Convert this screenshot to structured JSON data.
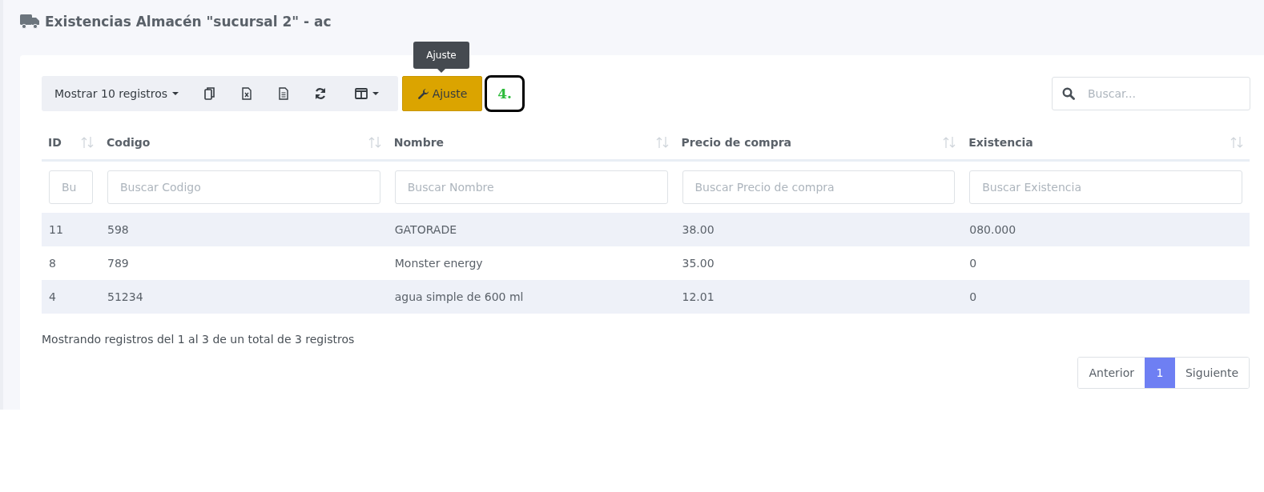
{
  "page_title": "Existencias Almacén \"sucursal 2\" - ac",
  "toolbar": {
    "length_menu": "Mostrar 10 registros",
    "buttons": [
      {
        "kind": "copy"
      },
      {
        "kind": "excel"
      },
      {
        "kind": "document"
      },
      {
        "kind": "refresh"
      },
      {
        "kind": "columns"
      }
    ],
    "adjust_button": "Ajuste",
    "tooltip": "Ajuste",
    "step_badge": "4."
  },
  "search": {
    "placeholder": "Buscar..."
  },
  "table": {
    "columns": [
      {
        "label": "ID",
        "filter_placeholder": "Bu"
      },
      {
        "label": "Codigo",
        "filter_placeholder": "Buscar Codigo"
      },
      {
        "label": "Nombre",
        "filter_placeholder": "Buscar Nombre"
      },
      {
        "label": "Precio de compra",
        "filter_placeholder": "Buscar Precio de compra"
      },
      {
        "label": "Existencia",
        "filter_placeholder": "Buscar Existencia"
      }
    ],
    "rows": [
      [
        "11",
        "598",
        "GATORADE",
        "38.00",
        "080.000"
      ],
      [
        "8",
        "789",
        "Monster energy",
        "35.00",
        "0"
      ],
      [
        "4",
        "51234",
        "agua simple de 600 ml",
        "12.01",
        "0"
      ]
    ]
  },
  "info": "Mostrando registros del 1 al 3 de un total de 3 registros",
  "pagination": {
    "previous": "Anterior",
    "pages": [
      {
        "label": "1",
        "selected": true
      }
    ],
    "next": "Siguiente"
  }
}
